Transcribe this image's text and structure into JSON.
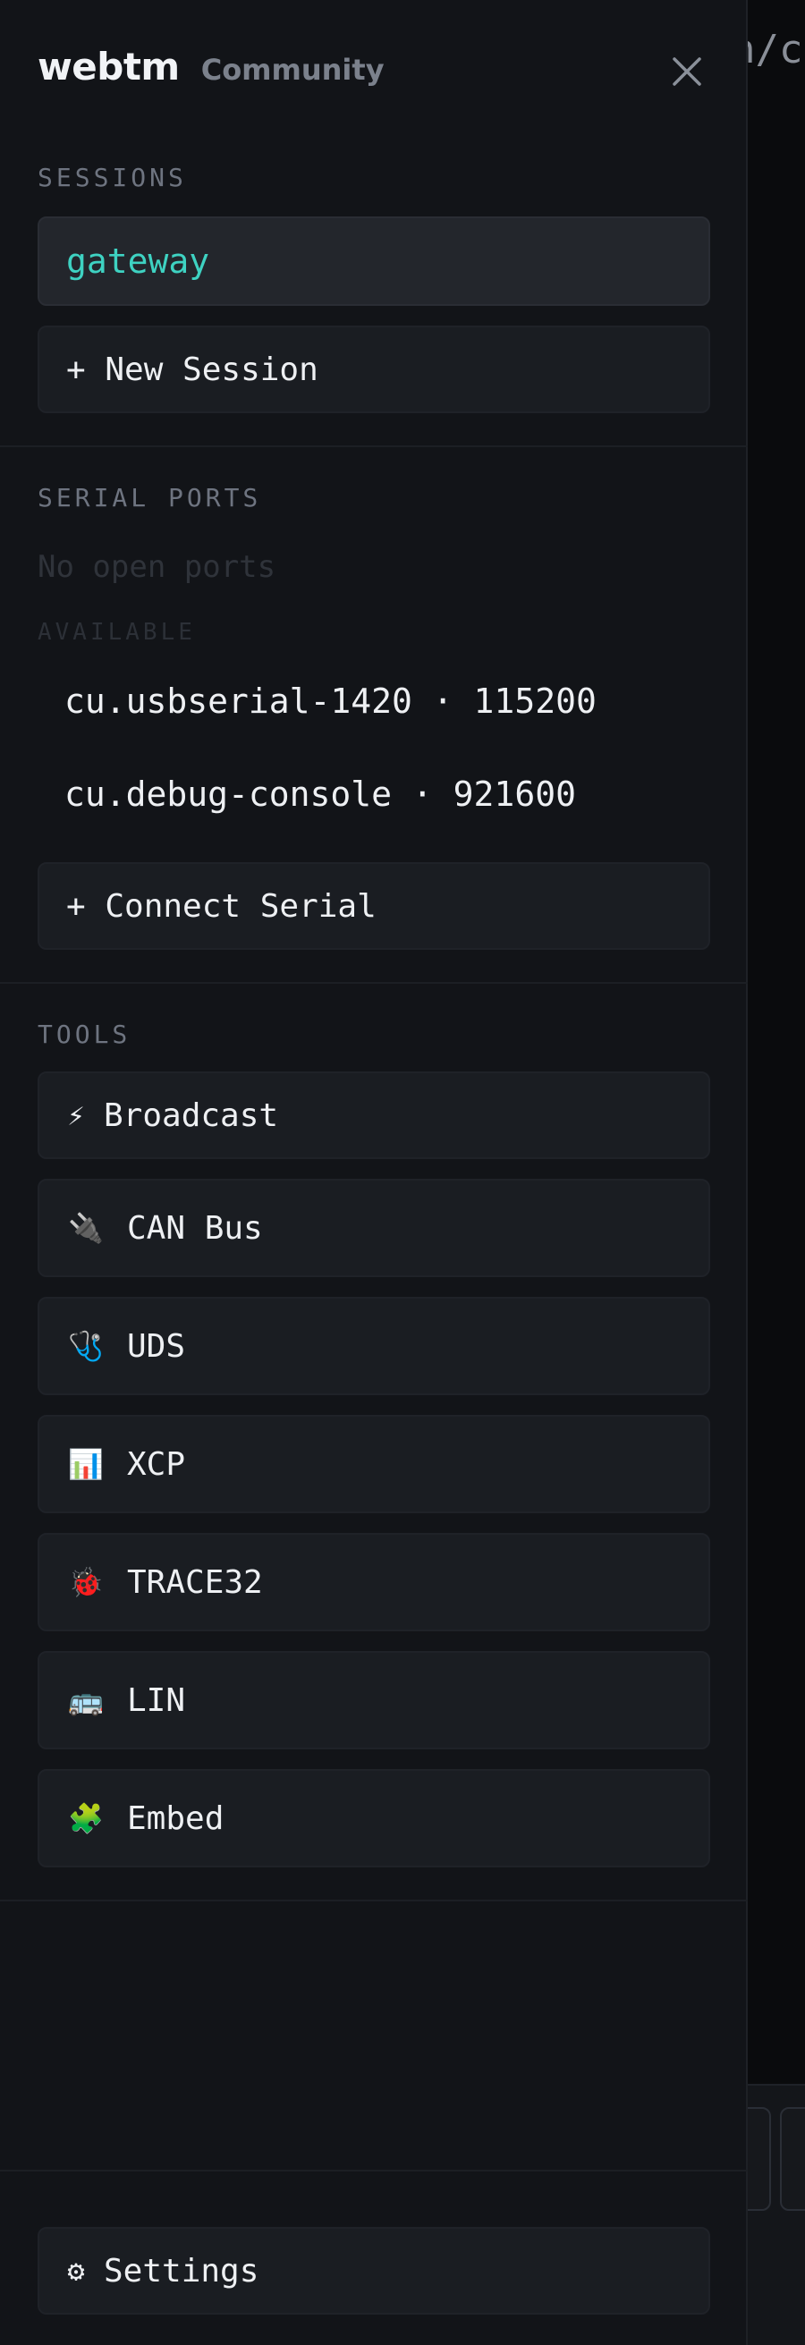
{
  "app": {
    "brand": "webtm",
    "edition": "Community"
  },
  "background": {
    "terminal_fragment": "n/ca"
  },
  "sessions": {
    "label": "SESSIONS",
    "items": [
      {
        "label": "gateway",
        "active": true
      }
    ],
    "new_label": "+ New Session"
  },
  "serial": {
    "label": "SERIAL PORTS",
    "empty_text": "No open ports",
    "available_label": "AVAILABLE",
    "ports": [
      {
        "label": "cu.usbserial-1420 · 115200"
      },
      {
        "label": "cu.debug-console · 921600"
      }
    ],
    "connect_label": "+ Connect Serial"
  },
  "tools": {
    "label": "TOOLS",
    "items": [
      {
        "icon": "⚡",
        "icon_name": "lightning-icon",
        "label": "Broadcast"
      },
      {
        "icon": "🔌",
        "icon_name": "plug-icon",
        "label": "CAN Bus"
      },
      {
        "icon": "🩺",
        "icon_name": "stethoscope-icon",
        "label": "UDS"
      },
      {
        "icon": "📊",
        "icon_name": "bar-chart-icon",
        "label": "XCP"
      },
      {
        "icon": "🐞",
        "icon_name": "bug-icon",
        "label": "TRACE32"
      },
      {
        "icon": "🚌",
        "icon_name": "bus-icon",
        "label": "LIN"
      },
      {
        "icon": "🧩",
        "icon_name": "puzzle-icon",
        "label": "Embed"
      }
    ]
  },
  "footer": {
    "settings_icon": "⚙",
    "settings_label": "Settings"
  },
  "colors": {
    "accent": "#3ed2c2",
    "drawer_bg": "#121418",
    "button_bg": "#1a1d22"
  }
}
